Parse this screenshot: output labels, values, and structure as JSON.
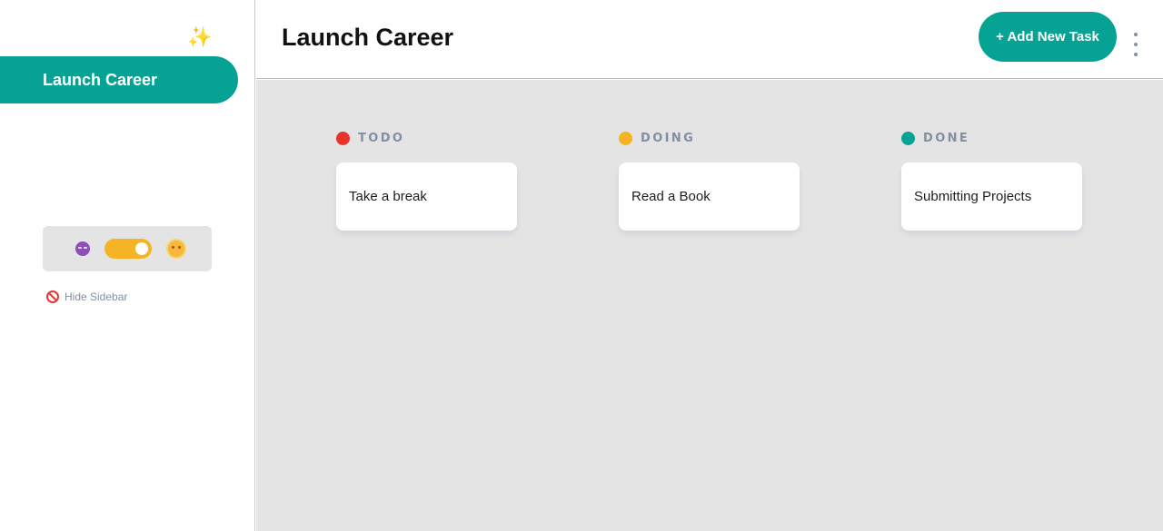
{
  "sidebar": {
    "sparkle_icon": "sparkle-icon",
    "boards": [
      {
        "label": "Launch Career",
        "active": true
      }
    ],
    "theme": {
      "moon_icon": "moon-face-icon",
      "sun_icon": "sun-face-icon",
      "toggle_on": true,
      "accent": "#f5b425"
    },
    "hide_label": "Hide Sidebar",
    "hide_icon": "no-entry-icon"
  },
  "header": {
    "title": "Launch Career",
    "add_task_label": "+ Add New Task",
    "menu_icon": "vertical-ellipsis-icon"
  },
  "colors": {
    "primary": "#06a293",
    "board_bg": "#e4e4e5",
    "todo": "#e8332b",
    "doing": "#f5b425",
    "done": "#06a293"
  },
  "columns": [
    {
      "title": "TODO",
      "color": "#e8332b",
      "tasks": [
        {
          "title": "Take a break"
        }
      ]
    },
    {
      "title": "DOING",
      "color": "#f5b425",
      "tasks": [
        {
          "title": "Read a Book"
        }
      ]
    },
    {
      "title": "DONE",
      "color": "#06a293",
      "tasks": [
        {
          "title": "Submitting Projects"
        }
      ]
    }
  ]
}
